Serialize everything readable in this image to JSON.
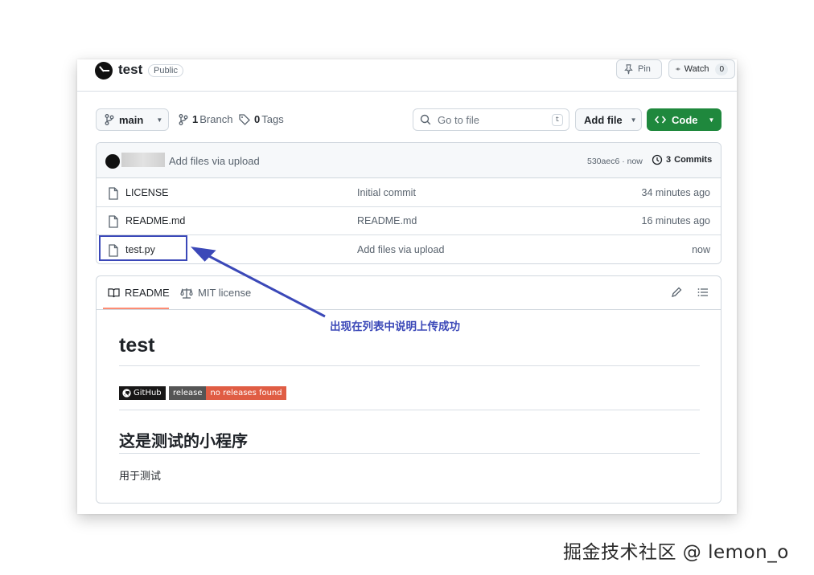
{
  "repo": {
    "name": "test",
    "visibility": "Public",
    "pin_label": "Pin",
    "watch_label": "Watch",
    "watch_count": "0"
  },
  "toolbar": {
    "branch": "main",
    "branch_count": "1",
    "branch_label": "Branch",
    "tag_count": "0",
    "tag_label": "Tags",
    "goto_placeholder": "Go to file",
    "goto_shortcut": "t",
    "add_file_label": "Add file",
    "code_label": "Code"
  },
  "latest_commit": {
    "message": "Add files via upload",
    "hash_time": "530aec6 · now",
    "commits_count": "3",
    "commits_label": "Commits"
  },
  "files": [
    {
      "name": "LICENSE",
      "commit": "Initial commit",
      "age": "34 minutes ago"
    },
    {
      "name": "README.md",
      "commit": "README.md",
      "age": "16 minutes ago"
    },
    {
      "name": "test.py",
      "commit": "Add files via upload",
      "age": "now"
    }
  ],
  "readme": {
    "tab_readme": "README",
    "tab_license": "MIT license",
    "h1": "test",
    "shield_github": "GitHub",
    "shield_release_left": "release",
    "shield_release_right": "no releases found",
    "h2": "这是测试的小程序",
    "paragraph": "用于测试"
  },
  "annotation": {
    "text": "出现在列表中说明上传成功",
    "color": "#3b48b8"
  },
  "watermark": "掘金技术社区 @ lemon_o",
  "colors": {
    "code_button": "#1f883d",
    "tab_underline": "#fd8c73",
    "shield_release_right": "#e05d44"
  }
}
